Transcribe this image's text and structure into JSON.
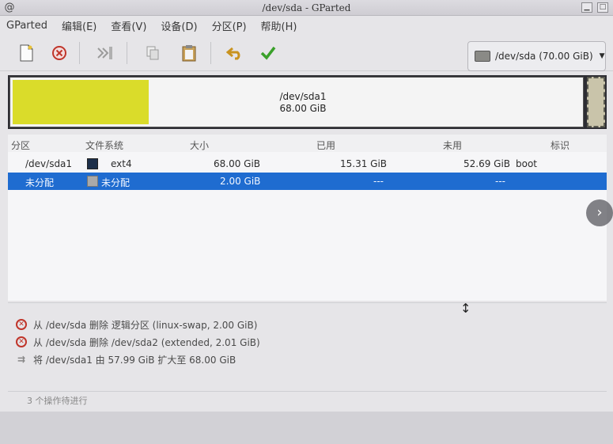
{
  "window": {
    "title": "/dev/sda - GParted"
  },
  "menubar": [
    "GParted",
    "编辑(E)",
    "查看(V)",
    "设备(D)",
    "分区(P)",
    "帮助(H)"
  ],
  "toolbar": {
    "icons": [
      "new-partition-icon",
      "delete-icon",
      "resize-move-icon",
      "copy-icon",
      "paste-icon",
      "undo-icon",
      "apply-icon"
    ]
  },
  "device_selector": {
    "value": "/dev/sda (70.00 GiB)"
  },
  "partition_map": {
    "name": "/dev/sda1",
    "size": "68.00 GiB",
    "used_fraction": 0.225
  },
  "table": {
    "headers": [
      "分区",
      "文件系统",
      "大小",
      "已用",
      "未用",
      "标识"
    ],
    "rows": [
      {
        "partition": "/dev/sda1",
        "filesystem": "ext4",
        "size": "68.00 GiB",
        "used": "15.31 GiB",
        "unused": "52.69 GiB",
        "flags": "boot",
        "swatch": "#1d2f4a"
      },
      {
        "partition": "未分配",
        "filesystem": "未分配",
        "size": "2.00 GiB",
        "used": "---",
        "unused": "---",
        "flags": "",
        "swatch": "#a9a9a9"
      }
    ]
  },
  "operations": [
    "从 /dev/sda 删除 逻辑分区 (linux-swap, 2.00 GiB)",
    "从 /dev/sda 删除 /dev/sda2 (extended, 2.01 GiB)",
    "将 /dev/sda1 由 57.99 GiB 扩大至 68.00 GiB"
  ],
  "status": "3 个操作待进行",
  "colors": {
    "used": "#dadc2a",
    "selected": "#1f6cd0",
    "error": "#c0352a"
  }
}
